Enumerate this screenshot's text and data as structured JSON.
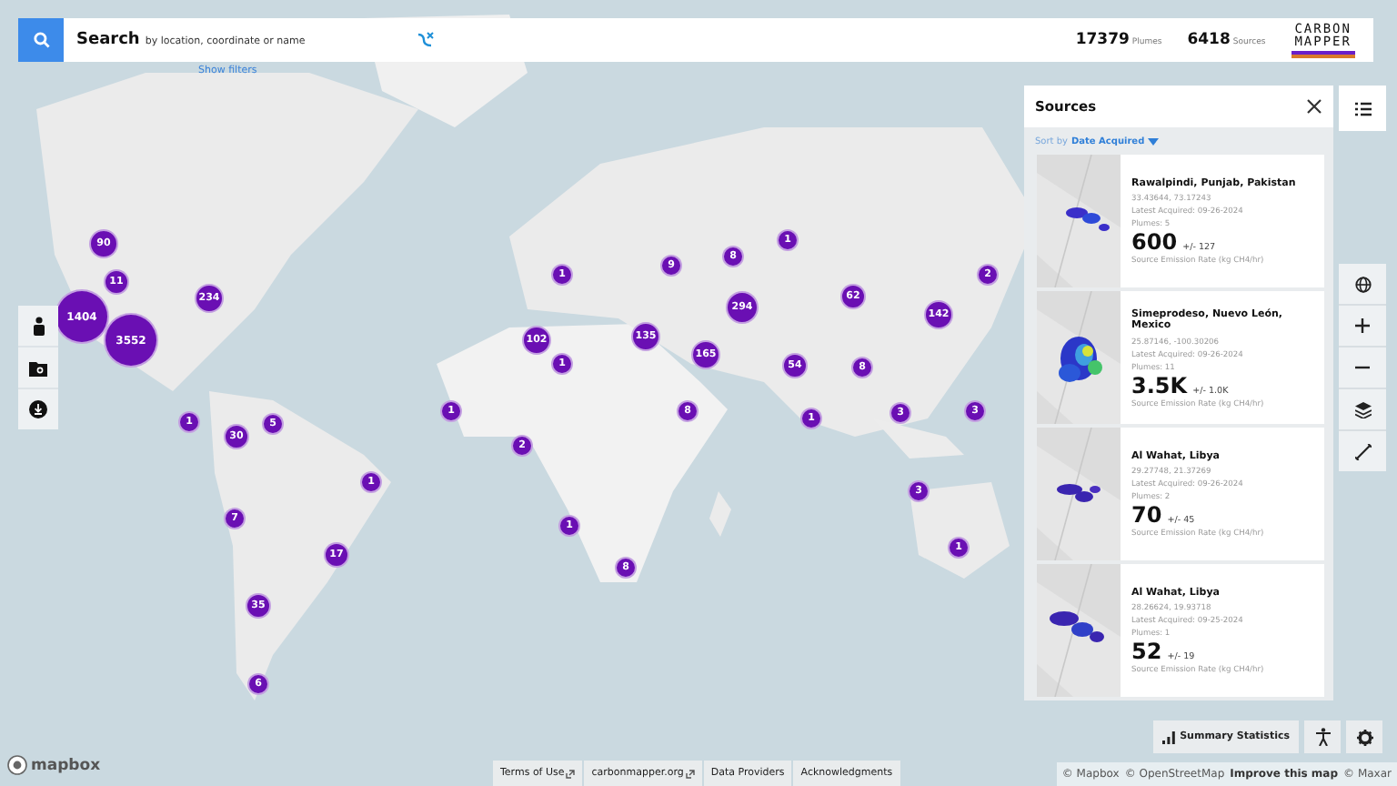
{
  "search": {
    "label": "Search",
    "placeholder": "by location, coordinate or name",
    "filters_link": "Show filters"
  },
  "stats": [
    {
      "value": "17379",
      "label": "Plumes"
    },
    {
      "value": "6418",
      "label": "Sources"
    }
  ],
  "logo": {
    "line_1": "CARBON",
    "line_2": "MAPPER"
  },
  "markers": [
    {
      "label": "90"
    },
    {
      "label": "11"
    },
    {
      "label": "1404"
    },
    {
      "label": "3552"
    },
    {
      "label": "234"
    },
    {
      "label": "1"
    },
    {
      "label": "30"
    },
    {
      "label": "5"
    },
    {
      "label": "1"
    },
    {
      "label": "7"
    },
    {
      "label": "17"
    },
    {
      "label": "35"
    },
    {
      "label": "6"
    },
    {
      "label": "1"
    },
    {
      "label": "1"
    },
    {
      "label": "102"
    },
    {
      "label": "1"
    },
    {
      "label": "2"
    },
    {
      "label": "1"
    },
    {
      "label": "8"
    },
    {
      "label": "9"
    },
    {
      "label": "8"
    },
    {
      "label": "1"
    },
    {
      "label": "135"
    },
    {
      "label": "165"
    },
    {
      "label": "294"
    },
    {
      "label": "8"
    },
    {
      "label": "54"
    },
    {
      "label": "1"
    },
    {
      "label": "62"
    },
    {
      "label": "8"
    },
    {
      "label": "142"
    },
    {
      "label": "2"
    },
    {
      "label": "3"
    },
    {
      "label": "3"
    },
    {
      "label": "3"
    },
    {
      "label": "1"
    }
  ],
  "sources_panel": {
    "title": "Sources",
    "sort_label": "Sort by",
    "sort_value": "Date Acquired",
    "cards": [
      {
        "name": "Rawalpindi, Punjab, Pakistan",
        "coordinates": "33.43644, 73.17243",
        "acquired": "Latest Acquired: 09-26-2024",
        "plumes": "Plumes: 5",
        "rate": "600",
        "uncertainty": "+/- 127",
        "rate_label": "Source Emission Rate (kg CH4/hr)"
      },
      {
        "name": "Simeprodeso, Nuevo León, Mexico",
        "coordinates": "25.87146, -100.30206",
        "acquired": "Latest Acquired: 09-26-2024",
        "plumes": "Plumes: 11",
        "rate": "3.5K",
        "uncertainty": "+/- 1.0K",
        "rate_label": "Source Emission Rate (kg CH4/hr)"
      },
      {
        "name": "Al Wahat, Libya",
        "coordinates": "29.27748, 21.37269",
        "acquired": "Latest Acquired: 09-26-2024",
        "plumes": "Plumes: 2",
        "rate": "70",
        "uncertainty": "+/- 45",
        "rate_label": "Source Emission Rate (kg CH4/hr)"
      },
      {
        "name": "Al Wahat, Libya",
        "coordinates": "28.26624, 19.93718",
        "acquired": "Latest Acquired: 09-25-2024",
        "plumes": "Plumes: 1",
        "rate": "52",
        "uncertainty": "+/- 19",
        "rate_label": "Source Emission Rate (kg CH4/hr)"
      }
    ]
  },
  "summary_button": "Summary Statistics",
  "footer_links": [
    {
      "label": "Terms of Use",
      "external": true
    },
    {
      "label": "carbonmapper.org",
      "external": true
    },
    {
      "label": "Data Providers",
      "external": false
    },
    {
      "label": "Acknowledgments",
      "external": false
    }
  ],
  "attribution": {
    "mapbox": "© Mapbox",
    "osm": "© OpenStreetMap",
    "improve": "Improve this map",
    "maxar": "© Maxar"
  },
  "mapbox_logo": "mapbox"
}
